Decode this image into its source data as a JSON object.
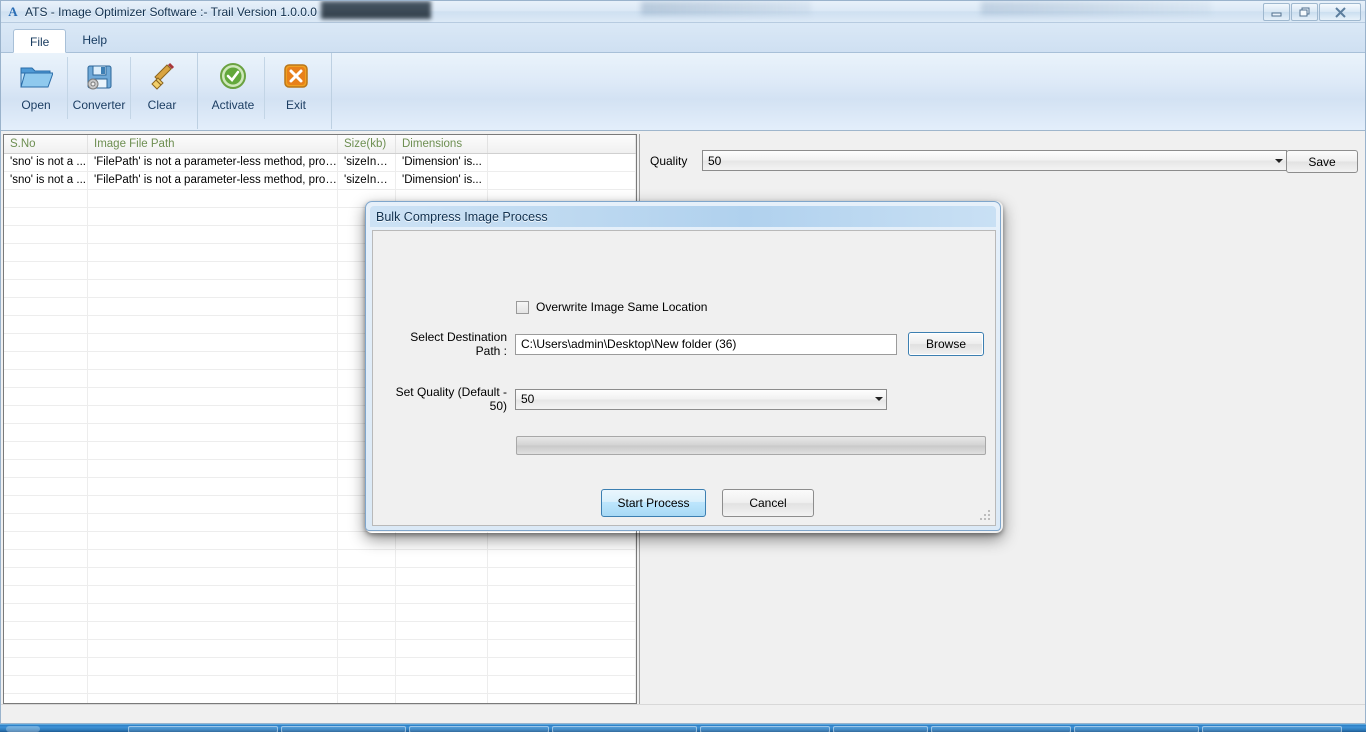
{
  "window": {
    "title": "ATS - Image Optimizer Software :- Trail Version 1.0.0.0",
    "icon": "app-letter-a-icon",
    "minimize_tip": "Minimize",
    "restore_tip": "Restore",
    "close_tip": "Close"
  },
  "ribbon": {
    "tabs": [
      {
        "label": "File",
        "active": true
      },
      {
        "label": "Help",
        "active": false
      }
    ],
    "groups": [
      {
        "buttons": [
          {
            "label": "Open",
            "icon": "open-folder-icon"
          },
          {
            "label": "Converter",
            "icon": "floppy-gear-icon"
          },
          {
            "label": "Clear",
            "icon": "broom-icon"
          }
        ]
      },
      {
        "buttons": [
          {
            "label": "Activate",
            "icon": "green-check-icon"
          },
          {
            "label": "Exit",
            "icon": "orange-x-icon"
          }
        ]
      }
    ]
  },
  "grid": {
    "columns": [
      "S.No",
      "Image File Path",
      "Size(kb)",
      "Dimensions",
      ""
    ],
    "rows": [
      {
        "sno": "'sno' is not a ...",
        "path": "'FilePath' is not a parameter-less method, property...",
        "size": "'sizeInKb'...",
        "dimensions": "'Dimension' is...",
        "rest": ""
      },
      {
        "sno": "'sno' is not a ...",
        "path": "'FilePath' is not a parameter-less method, property...",
        "size": "'sizeInKb'...",
        "dimensions": "'Dimension' is...",
        "rest": ""
      }
    ],
    "empty_row_count": 29,
    "header_color": "#6e8f52"
  },
  "right_panel": {
    "quality_label": "Quality",
    "quality_value": "50",
    "save_label": "Save"
  },
  "dialog": {
    "title": "Bulk Compress Image Process",
    "overwrite_checkbox_label": "Overwrite Image Same Location",
    "overwrite_checked": false,
    "path_label": "Select Destination Path :",
    "path_value": "C:\\Users\\admin\\Desktop\\New folder (36)",
    "browse_label": "Browse",
    "quality_label": "Set Quality (Default - 50)",
    "quality_value": "50",
    "progress_value": "0",
    "start_label": "Start Process",
    "cancel_label": "Cancel"
  },
  "colors": {
    "accent_blue": "#3c7fb1",
    "highlight_button": "#bee6fd",
    "grid_header_text": "#6e8f52",
    "title_text": "#12314f",
    "taskbar": "#2e7ab9"
  }
}
